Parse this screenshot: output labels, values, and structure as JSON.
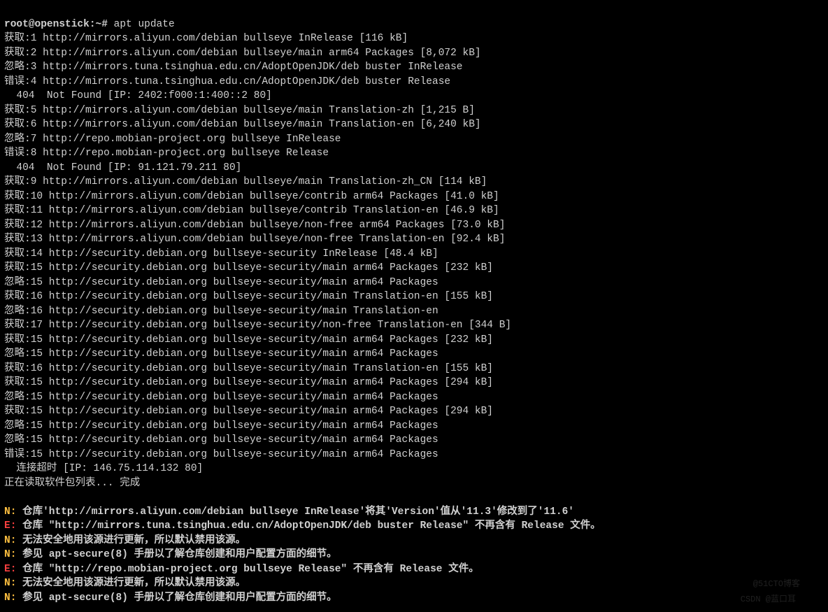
{
  "prompt": "root@openstick:~# ",
  "command": "apt update",
  "lines": [
    {
      "p": "获取",
      "n": "1",
      "t": " http://mirrors.aliyun.com/debian bullseye InRelease [116 kB]"
    },
    {
      "p": "获取",
      "n": "2",
      "t": " http://mirrors.aliyun.com/debian bullseye/main arm64 Packages [8,072 kB]"
    },
    {
      "p": "忽略",
      "n": "3",
      "t": " http://mirrors.tuna.tsinghua.edu.cn/AdoptOpenJDK/deb buster InRelease"
    },
    {
      "p": "错误",
      "n": "4",
      "t": " http://mirrors.tuna.tsinghua.edu.cn/AdoptOpenJDK/deb buster Release"
    },
    {
      "raw": "  404  Not Found [IP: 2402:f000:1:400::2 80]"
    },
    {
      "p": "获取",
      "n": "5",
      "t": " http://mirrors.aliyun.com/debian bullseye/main Translation-zh [1,215 B]"
    },
    {
      "p": "获取",
      "n": "6",
      "t": " http://mirrors.aliyun.com/debian bullseye/main Translation-en [6,240 kB]"
    },
    {
      "p": "忽略",
      "n": "7",
      "t": " http://repo.mobian-project.org bullseye InRelease"
    },
    {
      "p": "错误",
      "n": "8",
      "t": " http://repo.mobian-project.org bullseye Release"
    },
    {
      "raw": "  404  Not Found [IP: 91.121.79.211 80]"
    },
    {
      "p": "获取",
      "n": "9",
      "t": " http://mirrors.aliyun.com/debian bullseye/main Translation-zh_CN [114 kB]"
    },
    {
      "p": "获取",
      "n": "10",
      "t": " http://mirrors.aliyun.com/debian bullseye/contrib arm64 Packages [41.0 kB]"
    },
    {
      "p": "获取",
      "n": "11",
      "t": " http://mirrors.aliyun.com/debian bullseye/contrib Translation-en [46.9 kB]"
    },
    {
      "p": "获取",
      "n": "12",
      "t": " http://mirrors.aliyun.com/debian bullseye/non-free arm64 Packages [73.0 kB]"
    },
    {
      "p": "获取",
      "n": "13",
      "t": " http://mirrors.aliyun.com/debian bullseye/non-free Translation-en [92.4 kB]"
    },
    {
      "p": "获取",
      "n": "14",
      "t": " http://security.debian.org bullseye-security InRelease [48.4 kB]"
    },
    {
      "p": "获取",
      "n": "15",
      "t": " http://security.debian.org bullseye-security/main arm64 Packages [232 kB]"
    },
    {
      "p": "忽略",
      "n": "15",
      "t": " http://security.debian.org bullseye-security/main arm64 Packages"
    },
    {
      "p": "获取",
      "n": "16",
      "t": " http://security.debian.org bullseye-security/main Translation-en [155 kB]"
    },
    {
      "p": "忽略",
      "n": "16",
      "t": " http://security.debian.org bullseye-security/main Translation-en"
    },
    {
      "p": "获取",
      "n": "17",
      "t": " http://security.debian.org bullseye-security/non-free Translation-en [344 B]"
    },
    {
      "p": "获取",
      "n": "15",
      "t": " http://security.debian.org bullseye-security/main arm64 Packages [232 kB]"
    },
    {
      "p": "忽略",
      "n": "15",
      "t": " http://security.debian.org bullseye-security/main arm64 Packages"
    },
    {
      "p": "获取",
      "n": "16",
      "t": " http://security.debian.org bullseye-security/main Translation-en [155 kB]"
    },
    {
      "p": "获取",
      "n": "15",
      "t": " http://security.debian.org bullseye-security/main arm64 Packages [294 kB]"
    },
    {
      "p": "忽略",
      "n": "15",
      "t": " http://security.debian.org bullseye-security/main arm64 Packages"
    },
    {
      "p": "获取",
      "n": "15",
      "t": " http://security.debian.org bullseye-security/main arm64 Packages [294 kB]"
    },
    {
      "p": "忽略",
      "n": "15",
      "t": " http://security.debian.org bullseye-security/main arm64 Packages"
    },
    {
      "p": "忽略",
      "n": "15",
      "t": " http://security.debian.org bullseye-security/main arm64 Packages"
    },
    {
      "p": "错误",
      "n": "15",
      "t": " http://security.debian.org bullseye-security/main arm64 Packages"
    },
    {
      "raw": "  连接超时 [IP: 146.75.114.132 80]"
    },
    {
      "raw": "正在读取软件包列表... 完成"
    }
  ],
  "notices": [
    {
      "tag": "N:",
      "cls": "yel",
      "text": " 仓库'http://mirrors.aliyun.com/debian bullseye InRelease'将其'Version'值从'11.3'修改到了'11.6'"
    },
    {
      "tag": "E:",
      "cls": "red",
      "text": " 仓库 \"http://mirrors.tuna.tsinghua.edu.cn/AdoptOpenJDK/deb buster Release\" 不再含有 Release 文件。"
    },
    {
      "tag": "N:",
      "cls": "yel",
      "text": " 无法安全地用该源进行更新，所以默认禁用该源。"
    },
    {
      "tag": "N:",
      "cls": "yel",
      "text": " 参见 apt-secure(8) 手册以了解仓库创建和用户配置方面的细节。"
    },
    {
      "tag": "E:",
      "cls": "red",
      "text": " 仓库 \"http://repo.mobian-project.org bullseye Release\" 不再含有 Release 文件。"
    },
    {
      "tag": "N:",
      "cls": "yel",
      "text": " 无法安全地用该源进行更新，所以默认禁用该源。"
    },
    {
      "tag": "N:",
      "cls": "yel",
      "text": " 参见 apt-secure(8) 手册以了解仓库创建和用户配置方面的细节。"
    }
  ],
  "watermarks": {
    "top": "@51CTO博客",
    "bottom": "CSDN @蓝口耳"
  }
}
